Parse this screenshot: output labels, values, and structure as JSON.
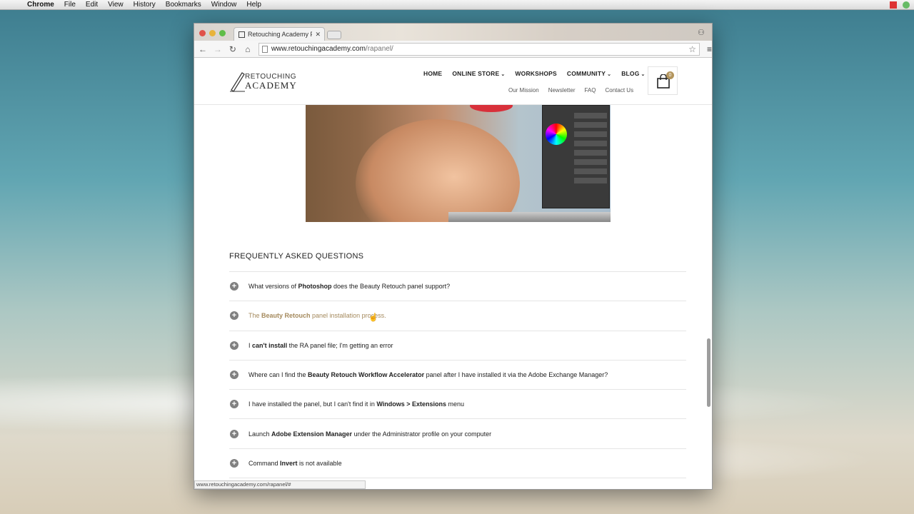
{
  "os_menubar": {
    "app": "Chrome",
    "items": [
      "File",
      "Edit",
      "View",
      "History",
      "Bookmarks",
      "Window",
      "Help"
    ]
  },
  "browser": {
    "tab_title": "Retouching Academy Pa",
    "url_host": "www.retouchingacademy.com",
    "url_path": "/rapanel/",
    "status_url": "www.retouchingacademy.com/rapanel/#"
  },
  "site": {
    "logo_line1": "RETOUCHING",
    "logo_line2": "ACADEMY",
    "main_nav": [
      "HOME",
      "ONLINE STORE",
      "WORKSHOPS",
      "COMMUNITY",
      "BLOG"
    ],
    "sub_nav": [
      "Our Mission",
      "Newsletter",
      "FAQ",
      "Contact Us"
    ],
    "cart_count": "0"
  },
  "faq": {
    "title": "FREQUENTLY ASKED QUESTIONS",
    "items": [
      {
        "pre": "What versions of ",
        "bold": "Photoshop",
        "post": " does the Beauty Retouch panel support?"
      },
      {
        "pre": "The ",
        "bold": "Beauty Retouch",
        "post": " panel installation process."
      },
      {
        "pre": "I ",
        "bold": "can't install",
        "post": " the RA panel file; I'm getting an error"
      },
      {
        "pre": "Where can I find the ",
        "bold": "Beauty Retouch Workflow Accelerator",
        "post": " panel after I have installed it via the Adobe Exchange Manager?"
      },
      {
        "pre": "I have installed the panel, but I can't find it in ",
        "bold": "Windows > Extensions",
        "post": " menu"
      },
      {
        "pre": "Launch ",
        "bold": "Adobe Extension Manager",
        "post": " under the Administrator profile on your computer"
      },
      {
        "pre": "Command ",
        "bold": "Invert",
        "post": " is not available"
      }
    ]
  },
  "colors": {
    "accent_gold": "#b3955d",
    "hover_text": "#a4895c"
  }
}
